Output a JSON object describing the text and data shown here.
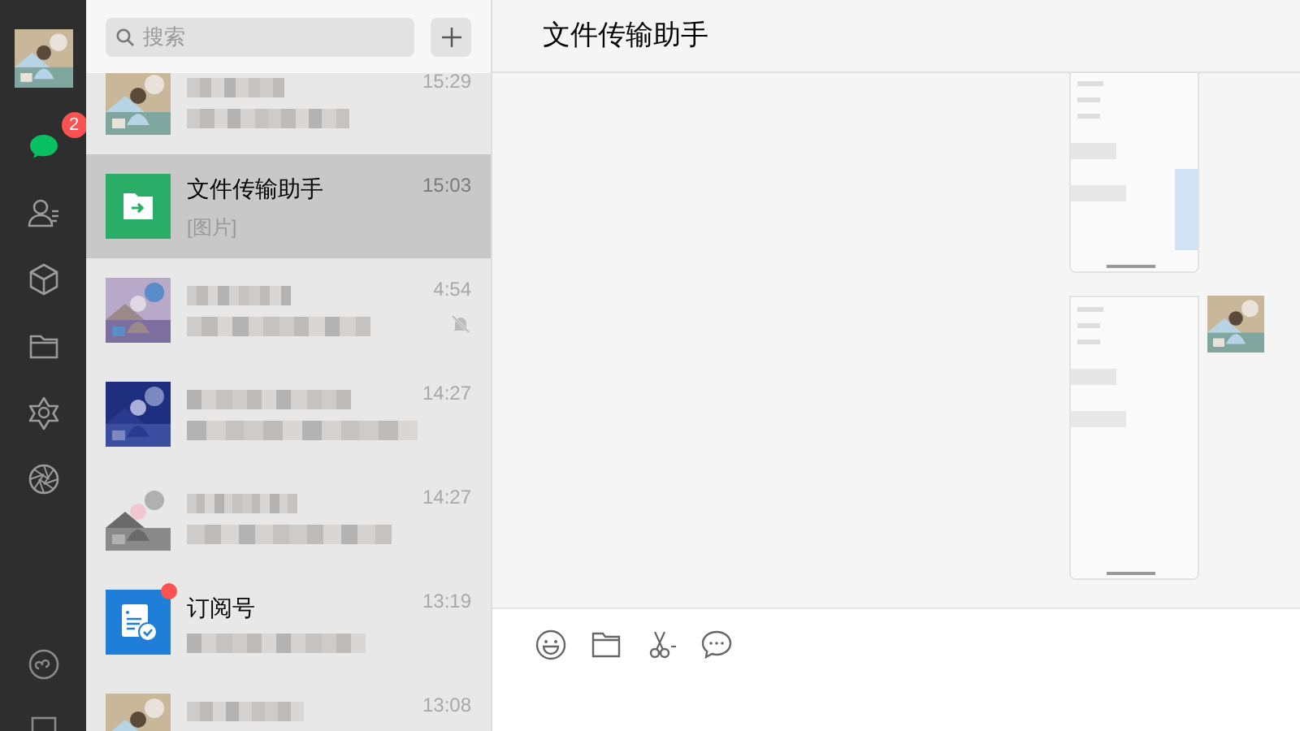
{
  "sidebar": {
    "items": [
      {
        "kind": "chats",
        "selected": true,
        "badge": "2"
      },
      {
        "kind": "contacts",
        "selected": false
      },
      {
        "kind": "favorites",
        "selected": false
      },
      {
        "kind": "files",
        "selected": false
      },
      {
        "kind": "moments",
        "selected": false
      },
      {
        "kind": "channels",
        "selected": false
      }
    ],
    "bottom_items": [
      {
        "kind": "mini_programs"
      },
      {
        "kind": "phone"
      }
    ]
  },
  "search": {
    "placeholder": "搜索"
  },
  "chats": [
    {
      "kind": "contact",
      "time": "15:29",
      "selected": false,
      "muted": false,
      "unread_dot": false
    },
    {
      "kind": "file_transfer",
      "name": "文件传输助手",
      "preview": "[图片]",
      "time": "15:03",
      "selected": true,
      "muted": false,
      "unread_dot": false
    },
    {
      "kind": "contact",
      "time": "4:54",
      "selected": false,
      "muted": true,
      "unread_dot": false
    },
    {
      "kind": "contact",
      "time": "14:27",
      "selected": false,
      "muted": false,
      "unread_dot": false
    },
    {
      "kind": "contact",
      "time": "14:27",
      "selected": false,
      "muted": false,
      "unread_dot": false
    },
    {
      "kind": "subscription",
      "name": "订阅号",
      "time": "13:19",
      "selected": false,
      "muted": false,
      "unread_dot": true
    },
    {
      "kind": "contact",
      "time": "13:08",
      "selected": false,
      "muted": false,
      "unread_dot": false
    }
  ],
  "conversation": {
    "title": "文件传输助手",
    "messages": [
      {
        "kind": "picture",
        "show_avatar": false
      },
      {
        "kind": "picture",
        "show_avatar": true
      }
    ],
    "toolbar": [
      {
        "kind": "emoji"
      },
      {
        "kind": "file"
      },
      {
        "kind": "screenshot"
      },
      {
        "kind": "chat_history"
      }
    ]
  }
}
